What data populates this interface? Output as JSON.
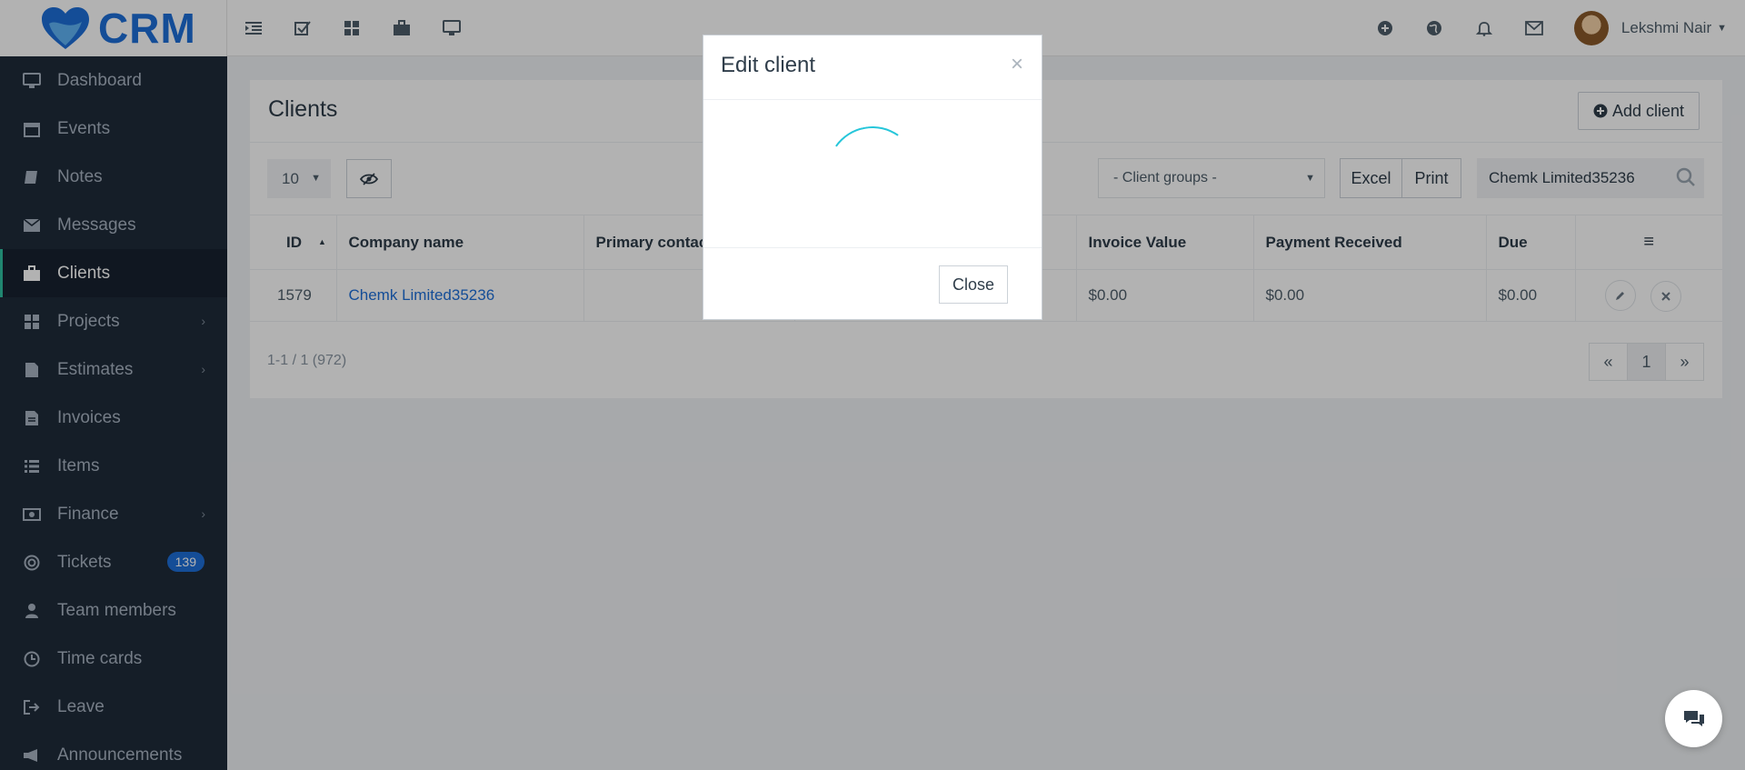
{
  "brand": {
    "logo_text": "CRM",
    "accent": "#1e6fd9",
    "sidebar_bg": "#1f2b3a",
    "active_border": "#2ec1a1"
  },
  "topbar": {
    "icons": [
      "menu-toggle-icon",
      "checkbox-icon",
      "grid-icon",
      "briefcase-icon",
      "desktop-icon"
    ],
    "right_icons": [
      "plus-circle-icon",
      "globe-icon",
      "bell-icon",
      "envelope-icon"
    ],
    "user_name": "Lekshmi Nair"
  },
  "sidebar": {
    "items": [
      {
        "label": "Dashboard",
        "icon": "desktop-icon"
      },
      {
        "label": "Events",
        "icon": "calendar-icon"
      },
      {
        "label": "Notes",
        "icon": "book-icon"
      },
      {
        "label": "Messages",
        "icon": "envelope-icon"
      },
      {
        "label": "Clients",
        "icon": "briefcase-icon",
        "active": true
      },
      {
        "label": "Projects",
        "icon": "grid-icon",
        "submenu": true
      },
      {
        "label": "Estimates",
        "icon": "file-icon",
        "submenu": true
      },
      {
        "label": "Invoices",
        "icon": "file-text-icon"
      },
      {
        "label": "Items",
        "icon": "list-icon"
      },
      {
        "label": "Finance",
        "icon": "money-icon",
        "submenu": true
      },
      {
        "label": "Tickets",
        "icon": "lifebuoy-icon",
        "badge": "139"
      },
      {
        "label": "Team members",
        "icon": "user-icon"
      },
      {
        "label": "Time cards",
        "icon": "clock-icon"
      },
      {
        "label": "Leave",
        "icon": "sign-out-icon"
      },
      {
        "label": "Announcements",
        "icon": "bullhorn-icon"
      }
    ]
  },
  "page": {
    "title": "Clients",
    "add_button": "Add client",
    "page_size": "10",
    "client_groups": "- Client groups -",
    "excel": "Excel",
    "print": "Print",
    "search_value": "Chemk Limited35236",
    "columns": [
      "ID",
      "Company name",
      "Primary contact",
      "",
      "Invoice Value",
      "Payment Received",
      "Due",
      "≡"
    ],
    "rows": [
      {
        "id": "1579",
        "company": "Chemk Limited35236",
        "contact": "",
        "extra": "",
        "invoice_value": "$0.00",
        "payment_received": "$0.00",
        "due": "$0.00"
      }
    ],
    "info": "1-1 / 1 (972)",
    "pager": {
      "prev": "«",
      "current": "1",
      "next": "»"
    }
  },
  "modal": {
    "title": "Edit client",
    "close_x": "×",
    "close_button": "Close",
    "spinner_color": "#26c6da"
  }
}
